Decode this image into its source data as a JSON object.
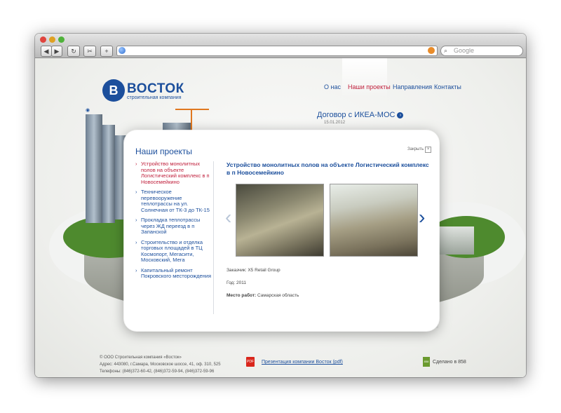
{
  "browser": {
    "back_icon": "back-arrow-icon",
    "forward_icon": "forward-arrow-icon",
    "search_placeholder": "Google"
  },
  "site": {
    "logo_title": "ВОСТОК",
    "logo_subtitle": "строительная компания",
    "nav": [
      {
        "label": "О нас"
      },
      {
        "label": "Наши проекты",
        "active": true
      },
      {
        "label": "Направления"
      },
      {
        "label": "Контакты"
      }
    ]
  },
  "news": {
    "title": "Договор с ИКЕА-МОС",
    "date": "15.01.2012"
  },
  "modal": {
    "title": "Наши проекты",
    "close_label": "Закрыть",
    "projects": [
      {
        "label": "Устройство монолитных полов на объекте Логистический комплекс в п Новосемейкино",
        "active": true
      },
      {
        "label": "Техническое перевооружение теплотрассы на ул. Солнечная от ТК-3 до ТК-15"
      },
      {
        "label": "Прокладка теплотрассы через ЖД переезд в п Запанской"
      },
      {
        "label": "Строительство и отделка торговых площадей в ТЦ Космопорт, Мегасити, Московский, Мега"
      },
      {
        "label": "Капитальный ремонт Покровского месторождения"
      }
    ],
    "project_heading": "Устройство монолитных полов на объекте Логистический комплекс в п Новосемейкино",
    "client_label": "Заказчик:",
    "client_value": "X5 Retail Group",
    "year_label": "Год:",
    "year_value": "2011",
    "location_label": "Место работ:",
    "location_value": "Самарская область"
  },
  "footer": {
    "company": "© ООО Строительная компания «Восток»",
    "address": "Адрес: 443080, г.Самара, Московское шоссе, 41, оф. 310, 525",
    "phones": "Телефоны: (846)372-60-42, (846)372-59-94, (846)372-59-96",
    "pdf_link": "Презентация компании Восток (pdf)",
    "pdf_icon": "PDF",
    "made_by": "Сделано в 858",
    "made_icon": "858"
  },
  "colors": {
    "brand_blue": "#1c4f9c",
    "active_red": "#c0213d"
  }
}
